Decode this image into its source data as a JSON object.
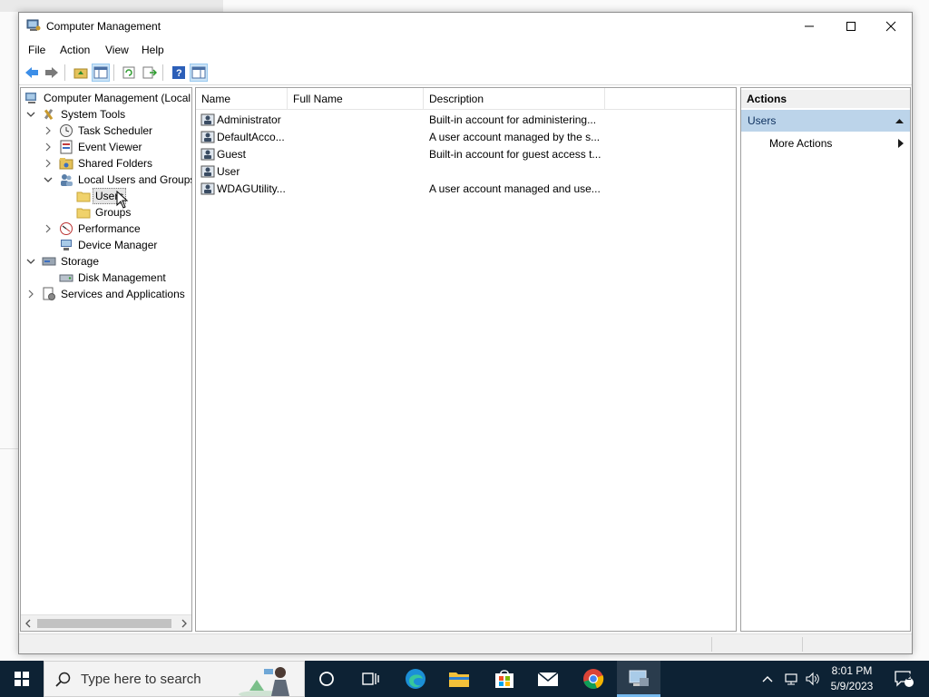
{
  "window": {
    "title": "Computer Management"
  },
  "menu": [
    "File",
    "Action",
    "View",
    "Help"
  ],
  "tree": {
    "root": "Computer Management (Local",
    "system_tools": "System Tools",
    "task_scheduler": "Task Scheduler",
    "event_viewer": "Event Viewer",
    "shared_folders": "Shared Folders",
    "local_users_groups": "Local Users and Groups",
    "users": "Users",
    "groups": "Groups",
    "performance": "Performance",
    "device_manager": "Device Manager",
    "storage": "Storage",
    "disk_management": "Disk Management",
    "services_apps": "Services and Applications"
  },
  "list": {
    "columns": [
      "Name",
      "Full Name",
      "Description"
    ],
    "rows": [
      {
        "name": "Administrator",
        "full_name": "",
        "description": "Built-in account for administering..."
      },
      {
        "name": "DefaultAcco...",
        "full_name": "",
        "description": "A user account managed by the s..."
      },
      {
        "name": "Guest",
        "full_name": "",
        "description": "Built-in account for guest access t..."
      },
      {
        "name": "User",
        "full_name": "",
        "description": ""
      },
      {
        "name": "WDAGUtility...",
        "full_name": "",
        "description": "A user account managed and use..."
      }
    ]
  },
  "actions": {
    "header": "Actions",
    "group": "Users",
    "more_actions": "More Actions"
  },
  "taskbar": {
    "search_placeholder": "Type here to search",
    "time": "8:01 PM",
    "date": "5/9/2023",
    "notification_count": "2"
  },
  "colors": {
    "taskbar": "#0d2234",
    "selection": "#bcd4ea",
    "accent": "#0078d4"
  }
}
